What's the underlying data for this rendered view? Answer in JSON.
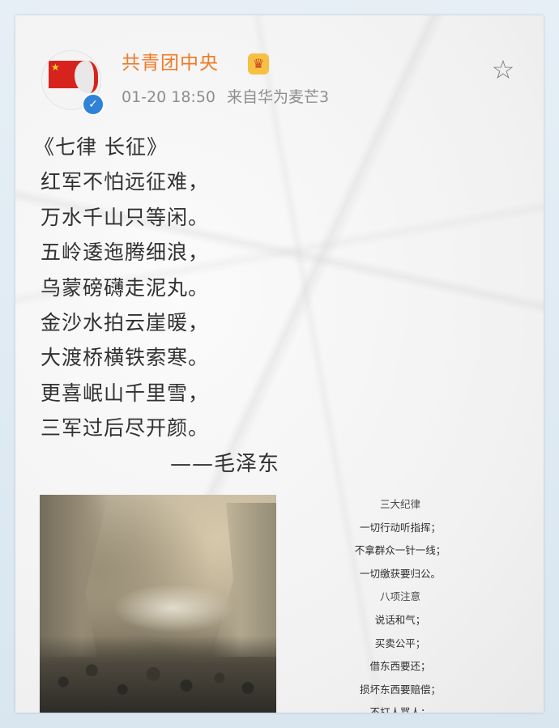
{
  "post": {
    "username": "共青团中央",
    "timestamp": "01-20 18:50",
    "source": "来自华为麦芒3"
  },
  "poem": {
    "lines": [
      "《七律 长征》",
      "红军不怕远征难，",
      "万水千山只等闲。",
      "五岭逶迤腾细浪，",
      "乌蒙磅礴走泥丸。",
      "金沙水拍云崖暖，",
      "大渡桥横铁索寒。",
      "更喜岷山千里雪，",
      "三军过后尽开颜。"
    ],
    "author": "——毛泽东"
  },
  "rules_image": {
    "lines": [
      "三大纪律",
      "一切行动听指挥；",
      "不拿群众一针一线；",
      "一切缴获要归公。",
      "八项注意",
      "说话和气；",
      "买卖公平；",
      "借东西要还；",
      "损坏东西要赔偿；",
      "不打人骂人；"
    ]
  },
  "icons": {
    "avatar": "communist-youth-league-logo",
    "verified": "verified-badge-icon",
    "vip": "crown-icon",
    "favorite": "star-icon"
  },
  "colors": {
    "username": "#f07b26",
    "meta": "#8e8e8e",
    "verified": "#2f82d8",
    "body_text": "#313131"
  }
}
